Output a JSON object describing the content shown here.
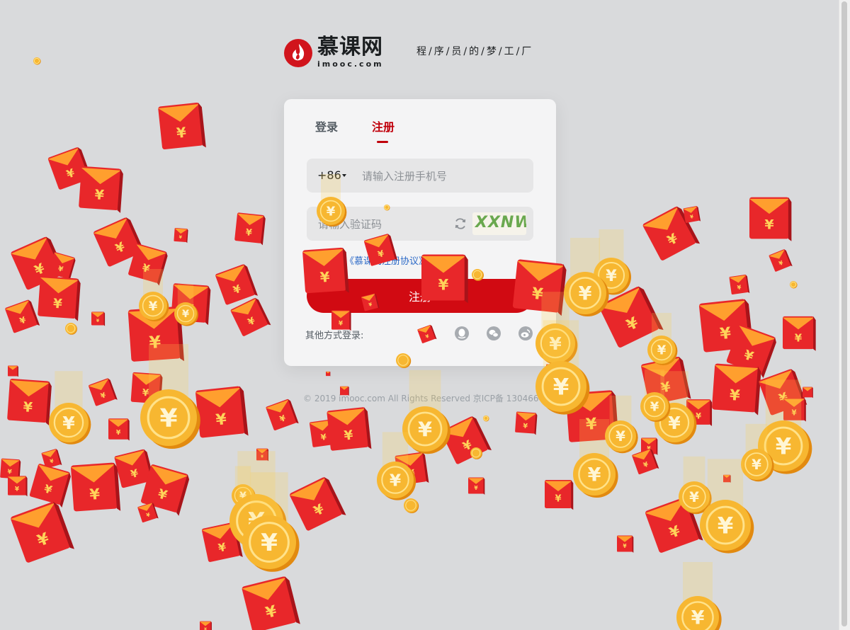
{
  "brand": {
    "name_cn": "慕课网",
    "name_en": "imooc.com",
    "slogan": "程/序/员/的/梦/工/厂",
    "accent_color": "#c0000b"
  },
  "tabs": [
    {
      "label": "登录",
      "active": false
    },
    {
      "label": "注册",
      "active": true
    }
  ],
  "register_form": {
    "country_code": "+86",
    "phone_placeholder": "请输入注册手机号",
    "code_placeholder": "请输入验证码",
    "captcha_text": "XXNW",
    "agreement_link": "《慕课网注册协议》",
    "submit_label": "注册",
    "other_login_label": "其他方式登录:",
    "social_icons": [
      "qq-icon",
      "wechat-icon",
      "weibo-icon"
    ]
  },
  "footer": {
    "copyright": "© 2019 imooc.com All Rights Reserved 京ICP备 13046642"
  },
  "decoration": {
    "overlay": "falling red envelopes and gold yuan coins",
    "envelope_color": "#e8272a",
    "coin_color": "#f7b731"
  }
}
